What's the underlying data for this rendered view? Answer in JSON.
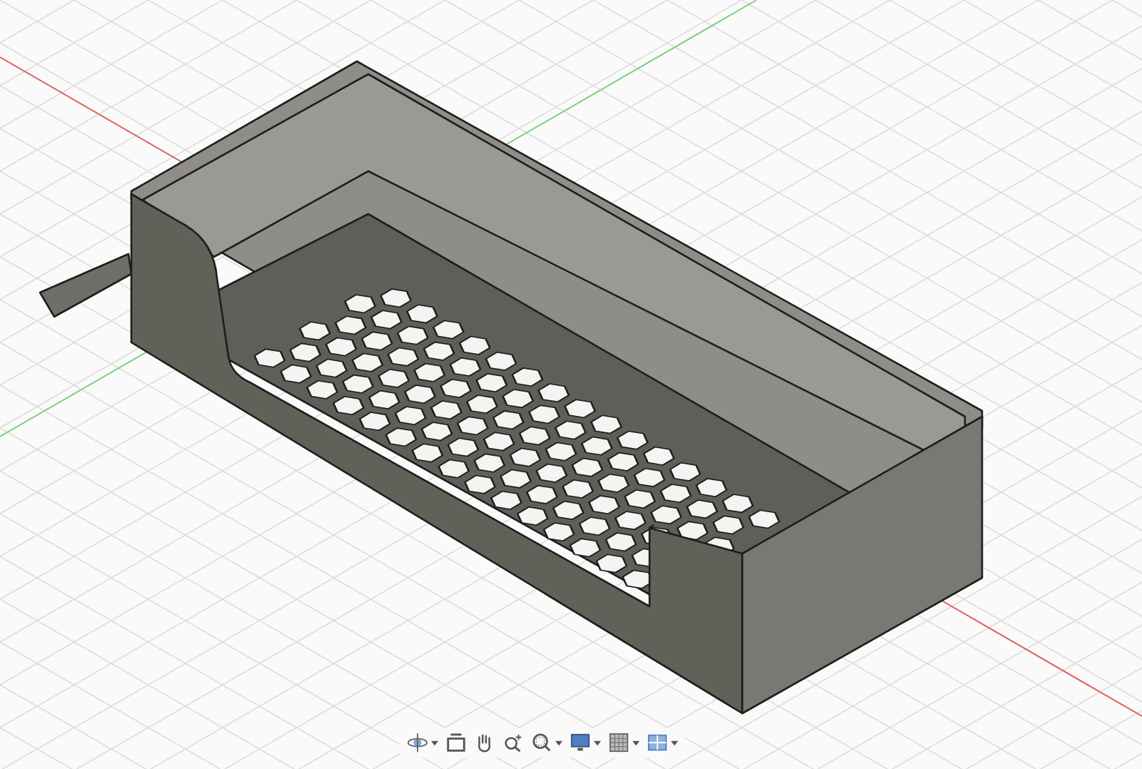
{
  "viewport": {
    "grid": true,
    "axes": true
  },
  "toolbar": {
    "tools": [
      {
        "kind": "orbit",
        "dropdown": true
      },
      {
        "kind": "look-at",
        "dropdown": false
      },
      {
        "kind": "pan",
        "dropdown": false
      },
      {
        "kind": "zoom",
        "dropdown": false
      },
      {
        "kind": "fit",
        "dropdown": true
      },
      {
        "kind": "display",
        "dropdown": true
      },
      {
        "kind": "grid",
        "dropdown": true
      },
      {
        "kind": "viewports",
        "dropdown": true
      }
    ]
  }
}
